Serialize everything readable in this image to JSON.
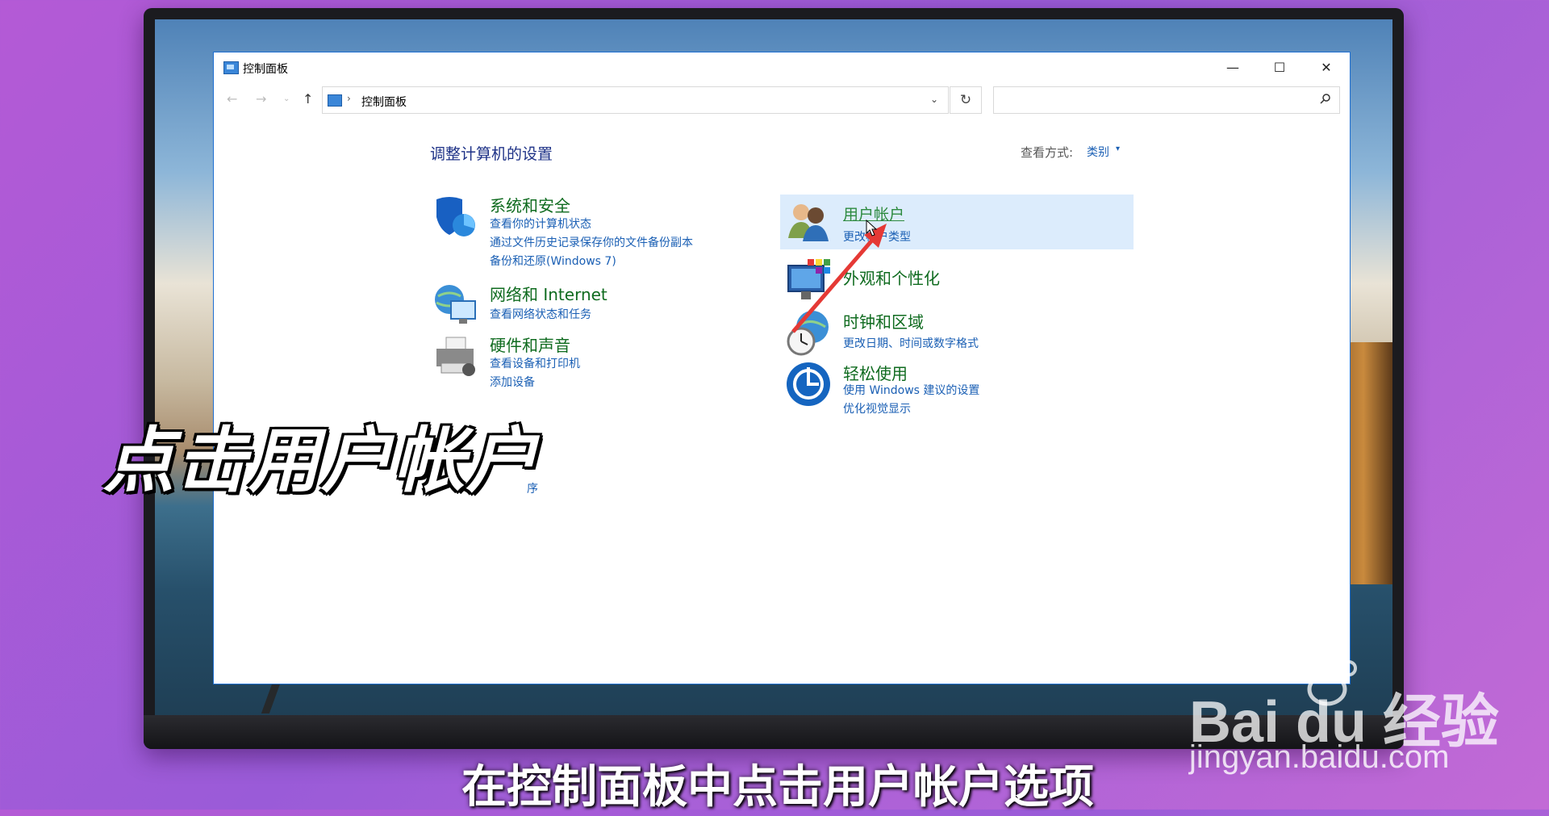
{
  "window": {
    "title": "控制面板"
  },
  "titlebar": {
    "minimize": "—",
    "maximize": "☐",
    "close": "✕"
  },
  "nav": {
    "back": "←",
    "forward": "→",
    "dropdown": "⌄",
    "up": "↑",
    "refresh": "↻"
  },
  "address": {
    "separator": "›",
    "location": "控制面板",
    "chevron": "⌄"
  },
  "search": {
    "value": "",
    "placeholder": ""
  },
  "content": {
    "page_title": "调整计算机的设置",
    "viewby_label": "查看方式:",
    "viewby_value": "类别",
    "left_categories": [
      {
        "heading": "系统和安全",
        "links": [
          "查看你的计算机状态",
          "通过文件历史记录保存你的文件备份副本",
          "备份和还原(Windows 7)"
        ]
      },
      {
        "heading": "网络和 Internet",
        "links": [
          "查看网络状态和任务"
        ]
      },
      {
        "heading": "硬件和声音",
        "links": [
          "查看设备和打印机",
          "添加设备"
        ]
      }
    ],
    "right_categories": [
      {
        "heading": "用户帐户",
        "links": [
          "更改帐户类型"
        ]
      },
      {
        "heading": "外观和个性化",
        "links": []
      },
      {
        "heading": "时钟和区域",
        "links": [
          "更改日期、时间或数字格式"
        ]
      },
      {
        "heading": "轻松使用",
        "links": [
          "使用 Windows 建议的设置",
          "优化视觉显示"
        ]
      }
    ],
    "partial_hidden_text": "序"
  },
  "overlay": {
    "title": "点击用户帐户",
    "subtitle": "在控制面板中点击用户帐户选项"
  },
  "watermark": {
    "logo": "Bai du 经验",
    "url": "jingyan.baidu.com"
  },
  "colors": {
    "accent": "#1a5fb4",
    "heading_green": "#0f6b1f",
    "highlight": "#dcecfc",
    "arrow": "#e53935"
  }
}
